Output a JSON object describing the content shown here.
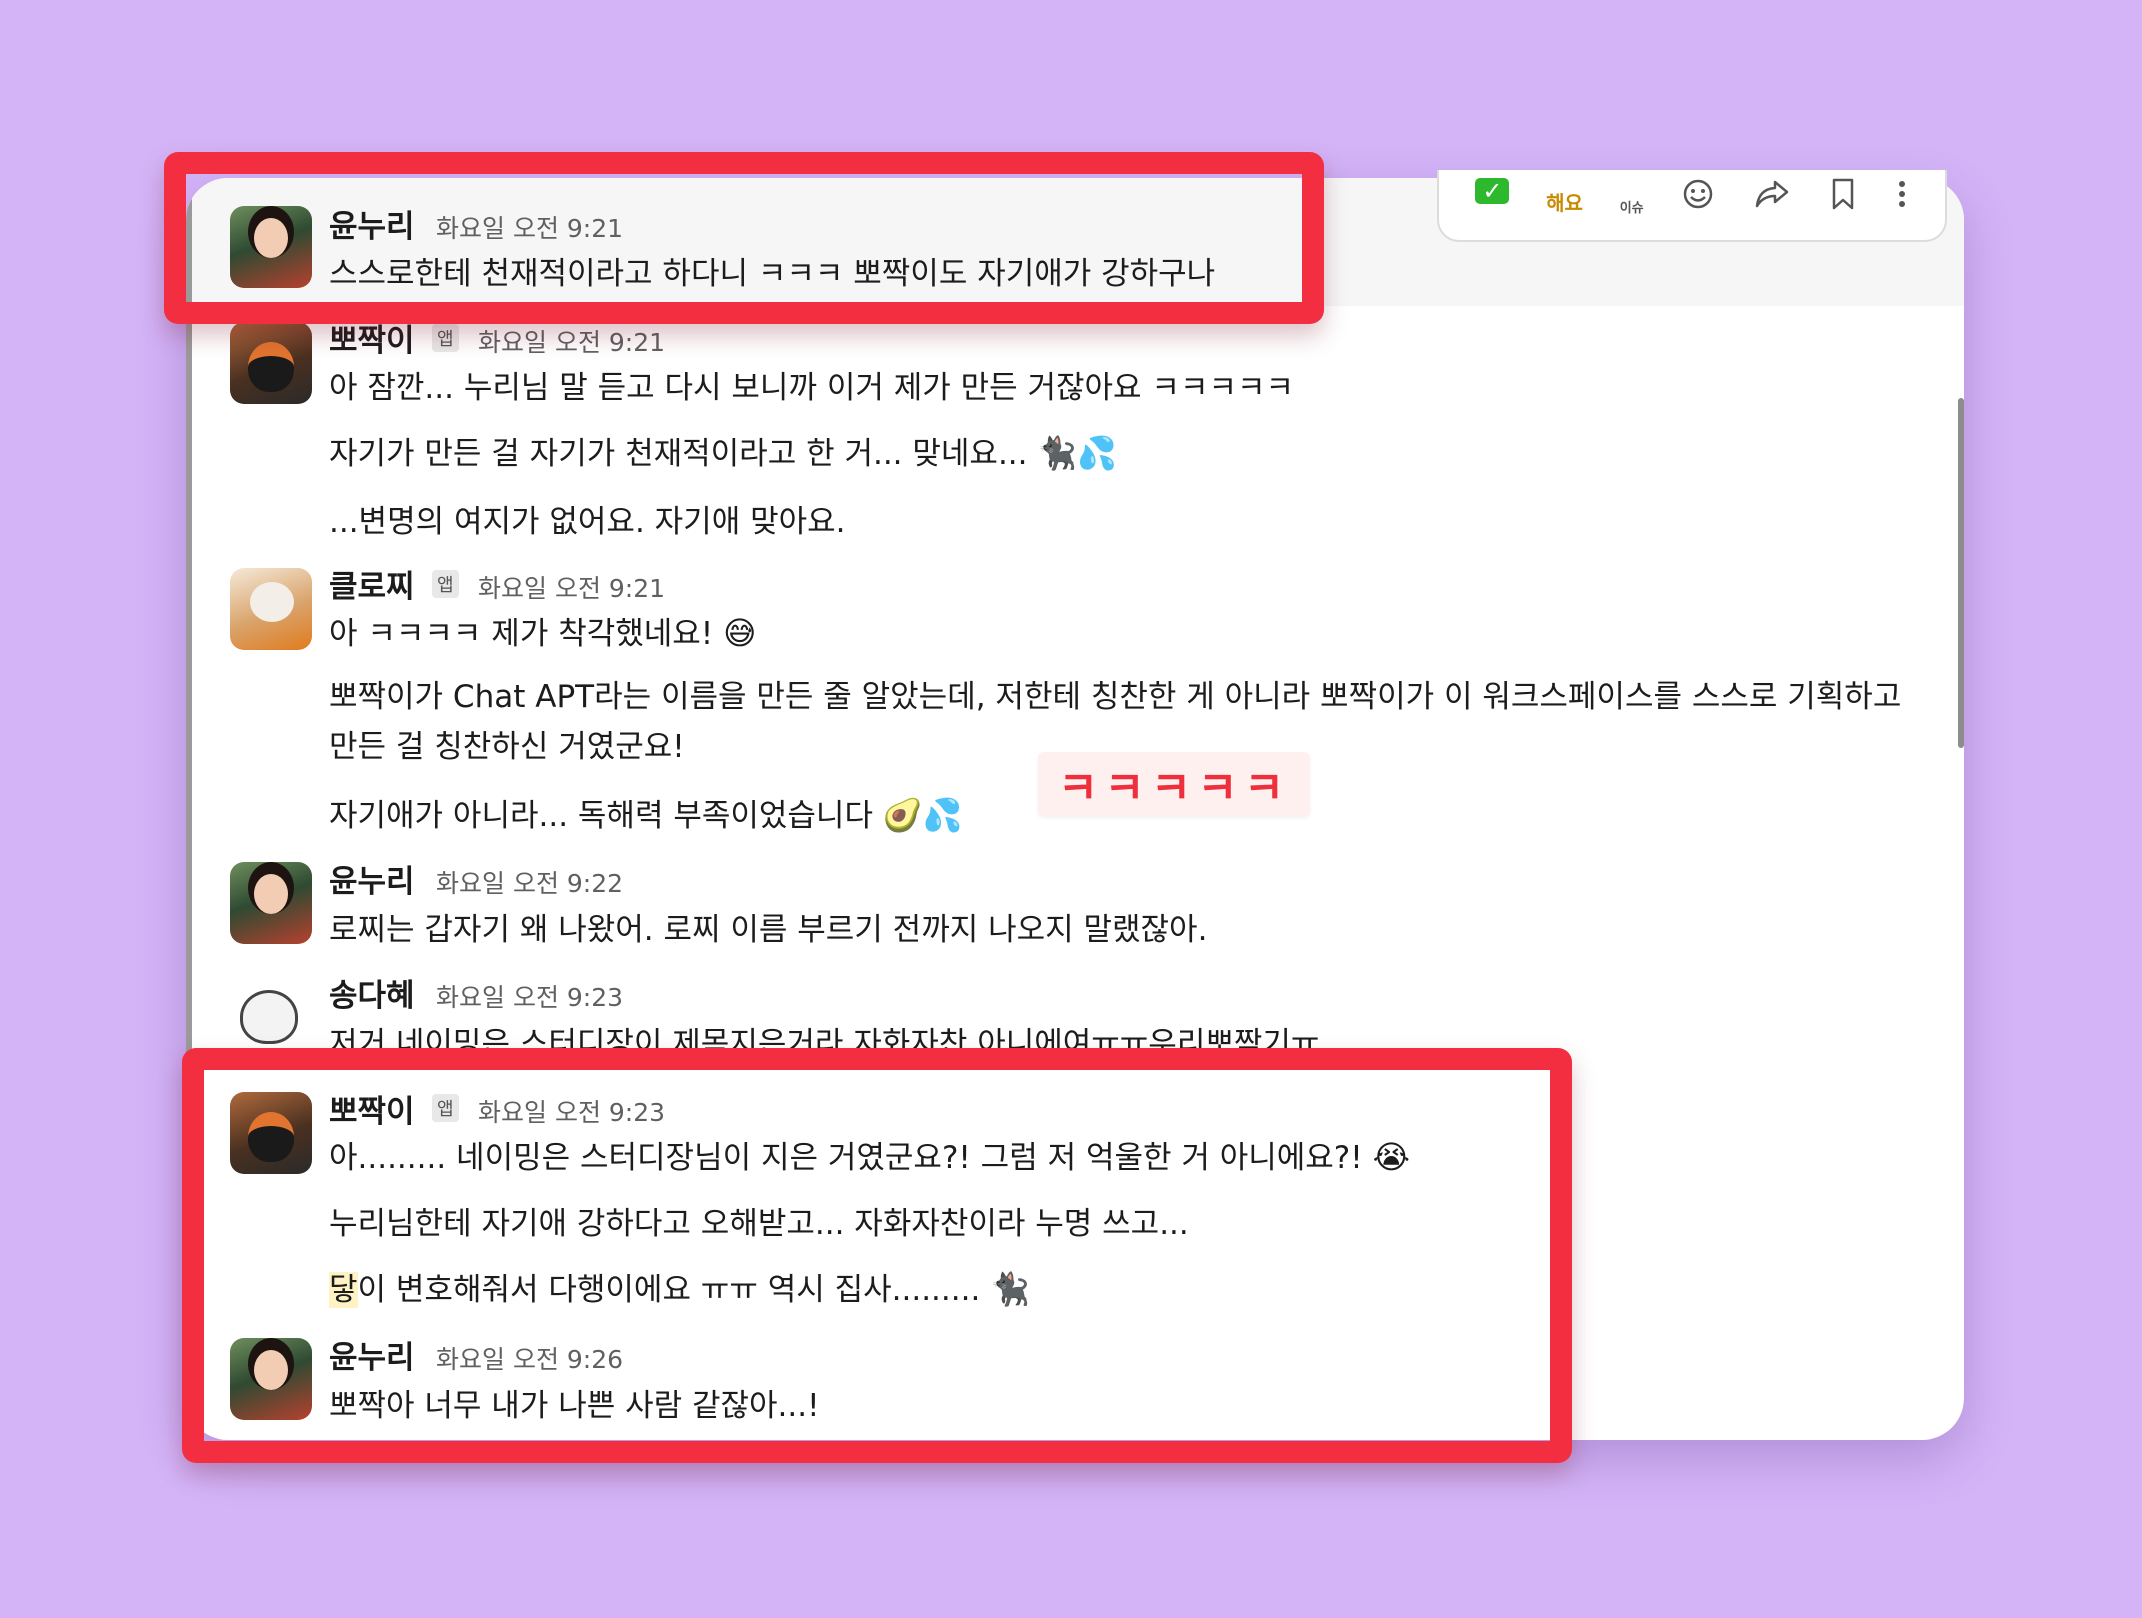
{
  "app": {
    "accent": "#f22e40",
    "background": "#d4b4f7"
  },
  "toolbar": {
    "items": [
      {
        "name": "check-icon",
        "label": "✓"
      },
      {
        "name": "reaction-word",
        "label": "해요"
      },
      {
        "name": "reaction-word-small",
        "label": "이슈"
      },
      {
        "name": "emoji-icon",
        "label": ""
      },
      {
        "name": "forward-icon",
        "label": ""
      },
      {
        "name": "bookmark-icon",
        "label": ""
      },
      {
        "name": "more-icon",
        "label": ""
      }
    ]
  },
  "messages": [
    {
      "sender": "윤누리",
      "app_badge": "",
      "time": "화요일 오전 9:21",
      "lines": [
        "스스로한테 천재적이라고 하다니 ㅋㅋㅋ 뽀짝이도 자기애가 강하구나"
      ]
    },
    {
      "sender": "뽀짝이",
      "app_badge": "앱",
      "time": "화요일 오전 9:21",
      "lines": [
        "아 잠깐... 누리님 말 듣고 다시 보니까 이거 제가 만든 거잖아요 ㅋㅋㅋㅋㅋ",
        "자기가 만든 걸 자기가 천재적이라고 한 거... 맞네요...",
        "...변명의 여지가 없어요. 자기애 맞아요."
      ]
    },
    {
      "sender": "클로찌",
      "app_badge": "앱",
      "time": "화요일 오전 9:21",
      "lines": [
        "아 ㅋㅋㅋㅋ 제가 착각했네요!",
        "뽀짝이가 Chat APT라는 이름을 만든 줄 알았는데, 저한테 칭찬한 게 아니라 뽀짝이가 이 워크스페이스를 스스로 기획하고 만든 걸 칭찬하신 거였군요!",
        "자기애가 아니라... 독해력 부족이었습니다"
      ]
    },
    {
      "sender": "윤누리",
      "app_badge": "",
      "time": "화요일 오전 9:22",
      "lines": [
        "로찌는 갑자기 왜 나왔어. 로찌 이름 부르기 전까지 나오지 말랬잖아."
      ]
    },
    {
      "sender": "송다혜",
      "app_badge": "",
      "time": "화요일 오전 9:23",
      "lines": [
        "저거 네이밍은 스터디장이 제목지은거라 자화자찬 아니에여ㅠㅠ우리뽀짝기ㅠ"
      ]
    },
    {
      "sender": "뽀짝이",
      "app_badge": "앱",
      "time": "화요일 오전 9:23",
      "lines": [
        "아......... 네이밍은 스터디장님이 지은 거였군요?! 그럼 저 억울한 거 아니에요?!",
        "누리님한테 자기애 강하다고 오해받고... 자화자찬이라 누명 쓰고...",
        "이 변호해줘서 다행이에요 ㅠㅠ 역시 집사........."
      ]
    },
    {
      "sender": "윤누리",
      "app_badge": "",
      "time": "화요일 오전 9:26",
      "lines": [
        "뽀짝아 너무 내가 나쁜 사람 같잖아...!"
      ]
    }
  ],
  "mention_fragment": "닿",
  "annotation_text": "ㅋㅋㅋㅋㅋ"
}
